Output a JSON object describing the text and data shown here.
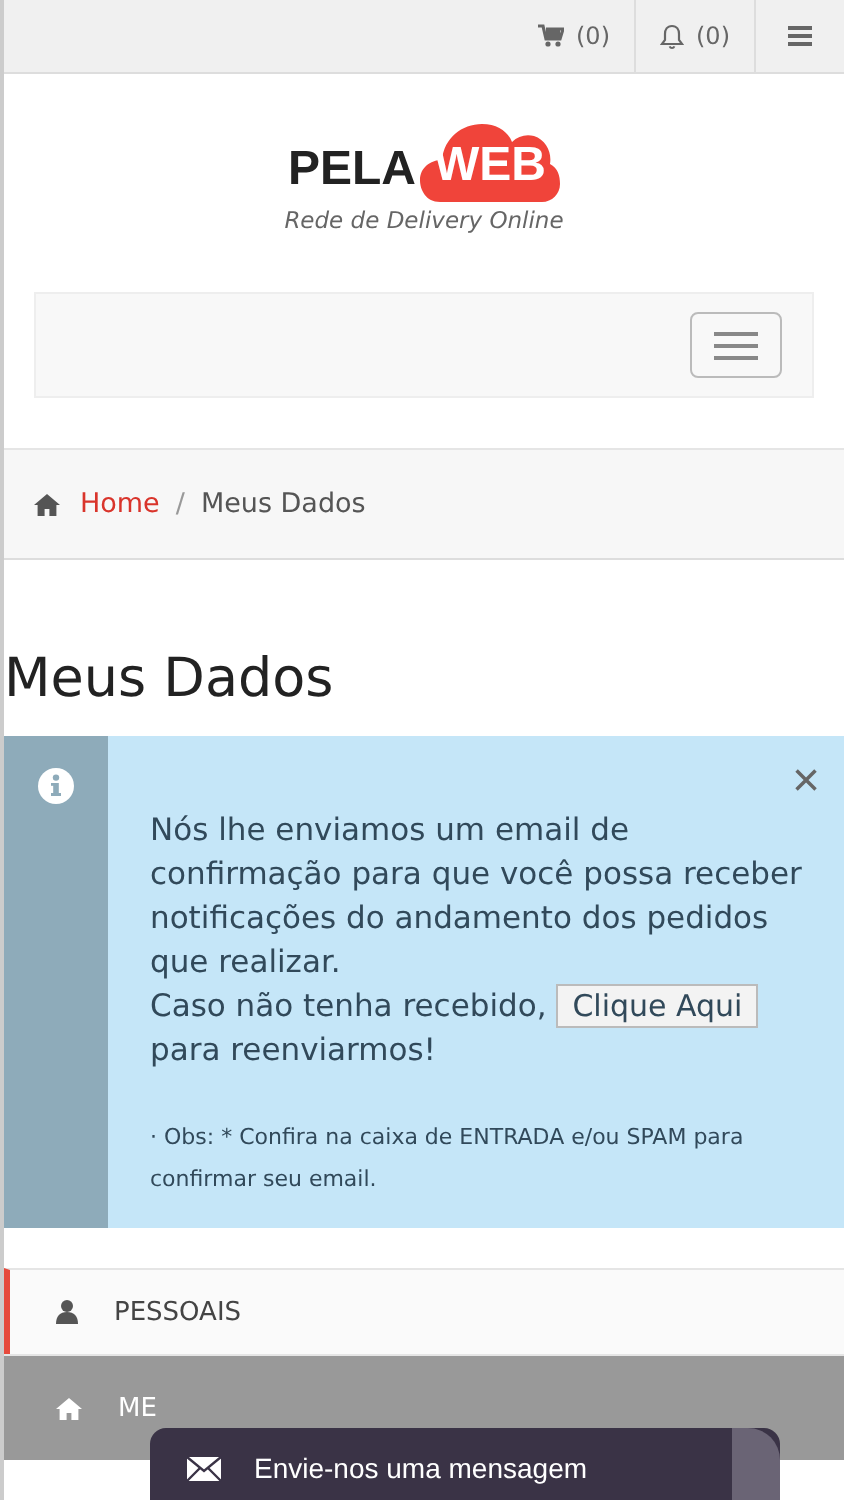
{
  "topbar": {
    "cart_count": "(0)",
    "notifications_count": "(0)"
  },
  "logo": {
    "left": "PELA",
    "right": "WEB",
    "tagline": "Rede de Delivery Online"
  },
  "breadcrumb": [
    {
      "label": "Home",
      "link": true
    },
    {
      "label": "Meus Dados",
      "link": false
    }
  ],
  "breadcrumb_separator": "/",
  "page_title": "Meus Dados",
  "alert": {
    "close": "×",
    "text_before": "Nós lhe enviamos um email de confirmação para que você possa receber notificações do andamento dos pedidos que realizar.",
    "text_mid": "Caso não tenha recebido,",
    "button": "Clique Aqui",
    "text_after": "para reenviarmos!",
    "note": "· Obs: * Confira na caixa de ENTRADA e/ou SPAM para confirmar seu email."
  },
  "menu": [
    {
      "label": "PESSOAIS",
      "kind": "user",
      "selected": true
    },
    {
      "label": "ME",
      "kind": "home",
      "selected": false
    }
  ],
  "chat": {
    "label": "Envie-nos uma mensagem"
  }
}
